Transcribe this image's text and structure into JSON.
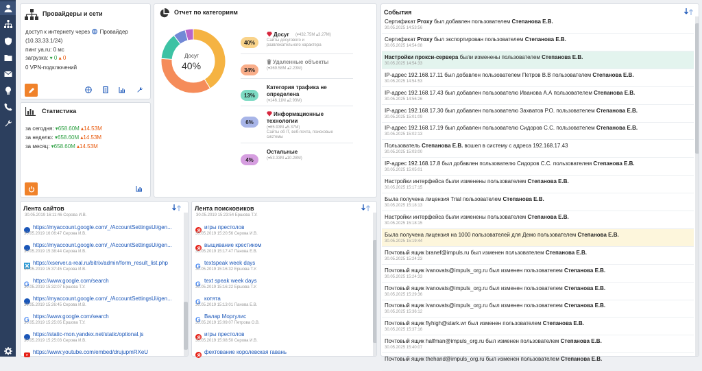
{
  "sidebar": {
    "items": [
      {
        "icon": "user-icon",
        "active": true
      },
      {
        "icon": "network-icon"
      },
      {
        "icon": "shield-icon"
      },
      {
        "icon": "folder-icon"
      },
      {
        "icon": "mail-icon"
      },
      {
        "icon": "lightbulb-icon"
      },
      {
        "icon": "phone-icon"
      },
      {
        "icon": "wrench-icon"
      },
      {
        "icon": "gear-icon"
      }
    ]
  },
  "providers": {
    "title": "Провайдеры и сети",
    "line1": "доступ к интернету через",
    "provider": "Провайдер",
    "line2": "(10.33.33.1/24)",
    "ping": "пинг ya.ru: 0 мс",
    "load_label": "загрузка:",
    "load_down": "▾ 0",
    "load_up": "▴ 0",
    "vpn": "0 VPN-подключений"
  },
  "stats": {
    "title": "Статистика",
    "rows": [
      {
        "label": "за сегодня:",
        "down": "▾658.60M",
        "up": "▴14.53M"
      },
      {
        "label": "за неделю:",
        "down": "▾658.60M",
        "up": "▴14.53M"
      },
      {
        "label": "за месяц:",
        "down": "▾658.60M",
        "up": "▴14.53M"
      }
    ]
  },
  "report": {
    "title": "Отчет по категориям",
    "center_label": "Досуг",
    "center_value": "40%",
    "categories": [
      {
        "pct": "40%",
        "name": "Досуг",
        "stat": "(▾432.75M ▴3.27M)",
        "desc": "Сайты досугового и развлекательного характера",
        "color": "#f5b342",
        "value": 40
      },
      {
        "pct": "34%",
        "name": "Удаленные объекты",
        "stat": "(▾369.58M ▴2.23M)",
        "desc": "",
        "color": "#f58c5a",
        "value": 34
      },
      {
        "pct": "13%",
        "name": "Категория трафика не определена",
        "stat": "(▾146.11M ▴2.93M)",
        "desc": "",
        "color": "#3dc2a4",
        "value": 13
      },
      {
        "pct": "6%",
        "name": "Информационные технологии",
        "stat": "(▾65.93M ▴5.37M)",
        "desc": "Сайты об IT, веб-почта, поисковые системы",
        "color": "#7289d6",
        "value": 6
      },
      {
        "pct": "4%",
        "name": "Остальные",
        "stat": "(▾53.33M ▴10.28M)",
        "desc": "",
        "color": "#b866c9",
        "value": 4
      }
    ]
  },
  "events": {
    "title": "События",
    "items": [
      {
        "parts": [
          [
            "Сертификат ",
            false
          ],
          [
            "Proxy",
            true
          ],
          [
            " был добавлен пользователем ",
            false
          ],
          [
            "Степанова Е.В.",
            true
          ]
        ],
        "date": "30.05.2025 14:53:56",
        "hl": ""
      },
      {
        "parts": [
          [
            "Сертификат ",
            false
          ],
          [
            "Proxy",
            true
          ],
          [
            " был экспортирован пользователем ",
            false
          ],
          [
            "Степанова Е.В.",
            true
          ]
        ],
        "date": "30.05.2025 14:54:08",
        "hl": ""
      },
      {
        "parts": [
          [
            "Настройки прокси-сервера",
            true
          ],
          [
            " были изменены пользователем ",
            false
          ],
          [
            "Степанова Е.В.",
            true
          ]
        ],
        "date": "30.05.2025 14:54:33",
        "hl": "green"
      },
      {
        "parts": [
          [
            "IP-адрес 192.168.17.11 был добавлен пользователем Петров В.В пользователем ",
            false
          ],
          [
            "Степанова Е.В.",
            true
          ]
        ],
        "date": "30.05.2025 14:54:53",
        "hl": ""
      },
      {
        "parts": [
          [
            "IP-адрес 192.168.17.43 был добавлен пользователю Иванова А.А пользователем ",
            false
          ],
          [
            "Степанова Е.В.",
            true
          ]
        ],
        "date": "30.05.2025 14:56:26",
        "hl": ""
      },
      {
        "parts": [
          [
            "IP-адрес 192.168.17.30 был добавлен пользователю Захватов Р.О. пользователем ",
            false
          ],
          [
            "Степанова Е.В.",
            true
          ]
        ],
        "date": "30.05.2025 15:01:09",
        "hl": ""
      },
      {
        "parts": [
          [
            "IP-адрес 192.168.17.19 был добавлен пользователю Сидоров С.С. пользователем ",
            false
          ],
          [
            "Степанова Е.В.",
            true
          ]
        ],
        "date": "30.05.2025 15:02:13",
        "hl": ""
      },
      {
        "parts": [
          [
            "Пользователь ",
            false
          ],
          [
            "Степанова Е.В.",
            true
          ],
          [
            " вошел в систему с адреса 192.168.17.43",
            false
          ]
        ],
        "date": "30.05.2025 15:03:00",
        "hl": ""
      },
      {
        "parts": [
          [
            "IP-адрес 192.168.17.8 был добавлен пользователю Сидоров С.С. пользователем ",
            false
          ],
          [
            "Степанова Е.В.",
            true
          ]
        ],
        "date": "30.05.2025 15:05:01",
        "hl": ""
      },
      {
        "parts": [
          [
            "Настройки интерфейса были изменены пользователем ",
            false
          ],
          [
            "Степанова Е.В.",
            true
          ]
        ],
        "date": "30.05.2025 15:17:15",
        "hl": ""
      },
      {
        "parts": [
          [
            "Была получена лицензия Trial пользователем ",
            false
          ],
          [
            "Степанова Е.В.",
            true
          ]
        ],
        "date": "30.05.2025 15:18:13",
        "hl": ""
      },
      {
        "parts": [
          [
            "Настройки интерфейса были изменены пользователем ",
            false
          ],
          [
            "Степанова Е.В.",
            true
          ]
        ],
        "date": "30.05.2025 15:18:15",
        "hl": ""
      },
      {
        "parts": [
          [
            "Была получена лицензия на 1000 пользователей для Демо пользователем ",
            false
          ],
          [
            "Степанова Е.В.",
            true
          ]
        ],
        "date": "30.05.2025 15:19:44",
        "hl": "yellow"
      },
      {
        "parts": [
          [
            "Почтовый ящик branef@impuls.ru был изменен пользователем ",
            false
          ],
          [
            "Степанова Е.В.",
            true
          ]
        ],
        "date": "30.05.2025 15:24:23",
        "hl": ""
      },
      {
        "parts": [
          [
            "Почтовый ящик ivanovats@impuls_org.ru был изменен пользователем ",
            false
          ],
          [
            "Степанова Е.В.",
            true
          ]
        ],
        "date": "30.05.2025 15:24:33",
        "hl": ""
      },
      {
        "parts": [
          [
            "Почтовый ящик ivanovats@impuls_org.ru был изменен пользователем ",
            false
          ],
          [
            "Степанова Е.В.",
            true
          ]
        ],
        "date": "30.05.2025 15:29:36",
        "hl": ""
      },
      {
        "parts": [
          [
            "Почтовый ящик ivanovats@impuls_org.ru был изменен пользователем ",
            false
          ],
          [
            "Степанова Е.В.",
            true
          ]
        ],
        "date": "30.05.2025 15:36:12",
        "hl": ""
      },
      {
        "parts": [
          [
            "Почтовый ящик flyhigh@stark.wr был изменен пользователем ",
            false
          ],
          [
            "Степанова Е.В.",
            true
          ]
        ],
        "date": "30.05.2025 15:37:16",
        "hl": ""
      },
      {
        "parts": [
          [
            "Почтовый ящик halfman@impuls_org.ru был изменен пользователем ",
            false
          ],
          [
            "Степанова Е.В.",
            true
          ]
        ],
        "date": "30.05.2025 15:40:07",
        "hl": ""
      },
      {
        "parts": [
          [
            "Почтовый ящик thehand@impuls_org.ru был изменен пользователем ",
            false
          ],
          [
            "Степанова Е.В.",
            true
          ]
        ],
        "date": "",
        "hl": ""
      }
    ]
  },
  "sites": {
    "title": "Лента сайтов",
    "partial_meta": "30.05.2019 16:11:46   Серова И.В.",
    "items": [
      {
        "icon": "globe",
        "link": "https://myaccount.google.com/_/AccountSettingsUi/gen...",
        "meta": "30.05.2019 16:06:47   Серова И.В."
      },
      {
        "icon": "globe",
        "link": "https://myaccount.google.com/_/AccountSettingsUi/gen...",
        "meta": "30.05.2019 15:38:44   Серова И.В."
      },
      {
        "icon": "xserver",
        "link": "https://xserver.a-real.ru/bitrix/admin/form_result_list.php",
        "meta": "30.05.2019 15:37:45   Серова И.В."
      },
      {
        "icon": "google",
        "link": "https://www.google.com/search",
        "meta": "30.05.2019 15:32:07   Ершова Т.У."
      },
      {
        "icon": "globe",
        "link": "https://myaccount.google.com/_/AccountSettingsUi/gen...",
        "meta": "30.05.2019 15:26:45   Серова И.В."
      },
      {
        "icon": "google",
        "link": "https://www.google.com/search",
        "meta": "30.05.2019 15:25:05   Ершова Т.У."
      },
      {
        "icon": "globe",
        "link": "https://static-mon.yandex.net/static/optional.js",
        "meta": "30.05.2019 15:25:03   Серова И.В."
      },
      {
        "icon": "youtube",
        "link": "https://www.youtube.com/embed/drujupmRXeU",
        "meta": ""
      }
    ]
  },
  "search": {
    "title": "Лента поисковиков",
    "partial_meta": "30.05.2019 15:23:54   Ершова Т.У.",
    "items": [
      {
        "icon": "yandex",
        "link": "игры престолов",
        "meta": "30.05.2019 15:20:56   Серова И.В."
      },
      {
        "icon": "yandex",
        "link": "выщивание крестиком",
        "meta": "30.05.2019 15:17:47   Панова Е.В."
      },
      {
        "icon": "google",
        "link": "textspeak week days",
        "meta": "30.05.2019 15:16:32   Ершова Т.У."
      },
      {
        "icon": "google",
        "link": "text speak week days",
        "meta": "30.05.2019 15:16:22   Ершова Т.У."
      },
      {
        "icon": "google",
        "link": "котята",
        "meta": "30.05.2019 15:13:01   Панова Е.В."
      },
      {
        "icon": "google",
        "link": "Валар Моргулис",
        "meta": "30.05.2019 15:09:07   Петрова О.В."
      },
      {
        "icon": "yandex",
        "link": "игры престолов",
        "meta": "30.05.2019 15:08:50   Серова И.В."
      },
      {
        "icon": "yandex",
        "link": "фехтование королевская гавань",
        "meta": ""
      }
    ]
  }
}
